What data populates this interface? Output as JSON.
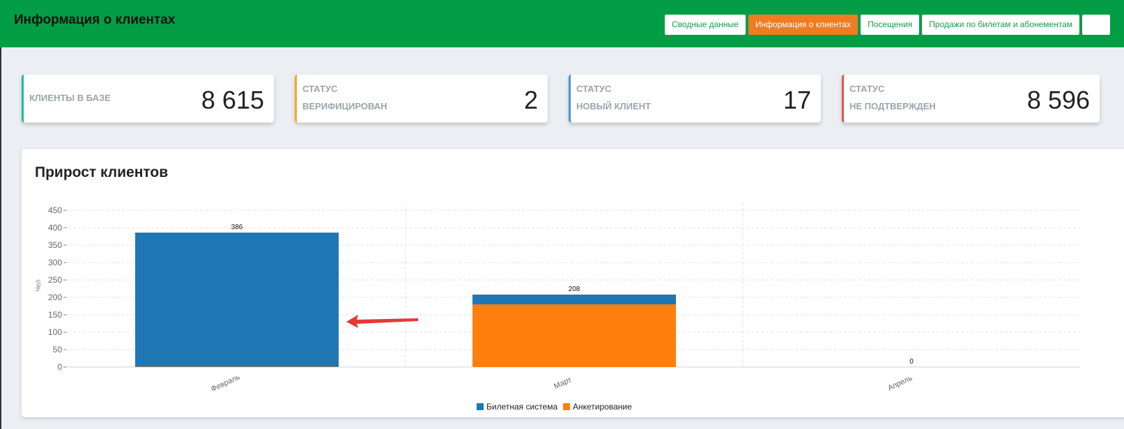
{
  "header": {
    "title": "Информация о клиентах",
    "nav": [
      {
        "label": "Сводные данные",
        "active": false
      },
      {
        "label": "Информация о клиентах",
        "active": true
      },
      {
        "label": "Посещения",
        "active": false
      },
      {
        "label": "Продажи по билетам и абонементам",
        "active": false
      }
    ]
  },
  "cards": [
    {
      "line1": "",
      "line2": "КЛИЕНТЫ В БАЗЕ",
      "value": "8 615",
      "color": "#1abc9c"
    },
    {
      "line1": "СТАТУС",
      "line2": "ВЕРИФИЦИРОВАН",
      "value": "2",
      "color": "#f5a623"
    },
    {
      "line1": "СТАТУС",
      "line2": "НОВЫЙ КЛИЕНТ",
      "value": "17",
      "color": "#4a90e2"
    },
    {
      "line1": "СТАТУС",
      "line2": "НЕ ПОДТВЕРЖДЕН",
      "value": "8 596",
      "color": "#e05555"
    }
  ],
  "chart_title": "Прирост клиентов",
  "chart_data": {
    "type": "bar",
    "stacked": true,
    "categories": [
      "Февраль",
      "Март",
      "Апрель"
    ],
    "series": [
      {
        "name": "Билетная система",
        "color": "#1f77b4",
        "values": [
          385,
          28,
          0
        ]
      },
      {
        "name": "Анкетирование",
        "color": "#ff7f0e",
        "values": [
          1,
          180,
          0
        ]
      }
    ],
    "totals": [
      "386",
      "208",
      "0"
    ],
    "ylabel": "Чел",
    "ylim": [
      0,
      450
    ],
    "yticks": [
      0,
      50,
      100,
      150,
      200,
      250,
      300,
      350,
      400,
      450
    ],
    "grid": true,
    "legend": "bottom"
  }
}
